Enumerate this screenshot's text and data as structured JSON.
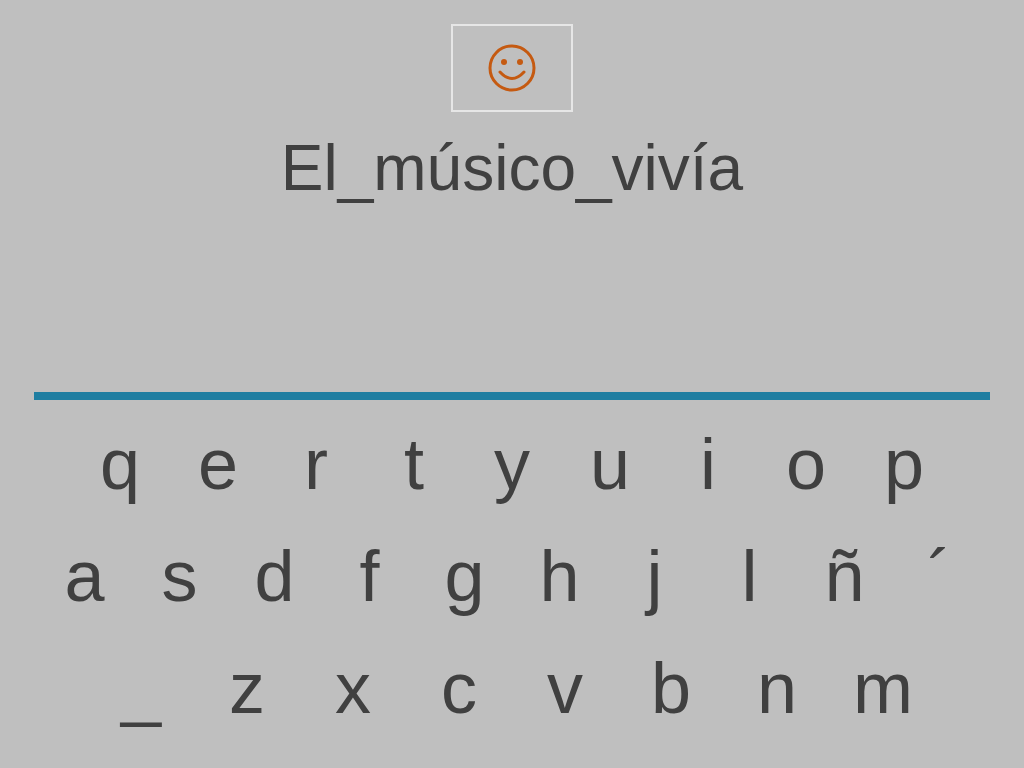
{
  "word": "El_músico_vivía",
  "keyboard": [
    [
      "q",
      "e",
      "r",
      "t",
      "y",
      "u",
      "i",
      "o",
      "p"
    ],
    [
      "a",
      "s",
      "d",
      "f",
      "g",
      "h",
      "j",
      "l",
      "ñ",
      "´"
    ],
    [
      "_",
      "z",
      "x",
      "c",
      "v",
      "b",
      "n",
      "m"
    ]
  ]
}
